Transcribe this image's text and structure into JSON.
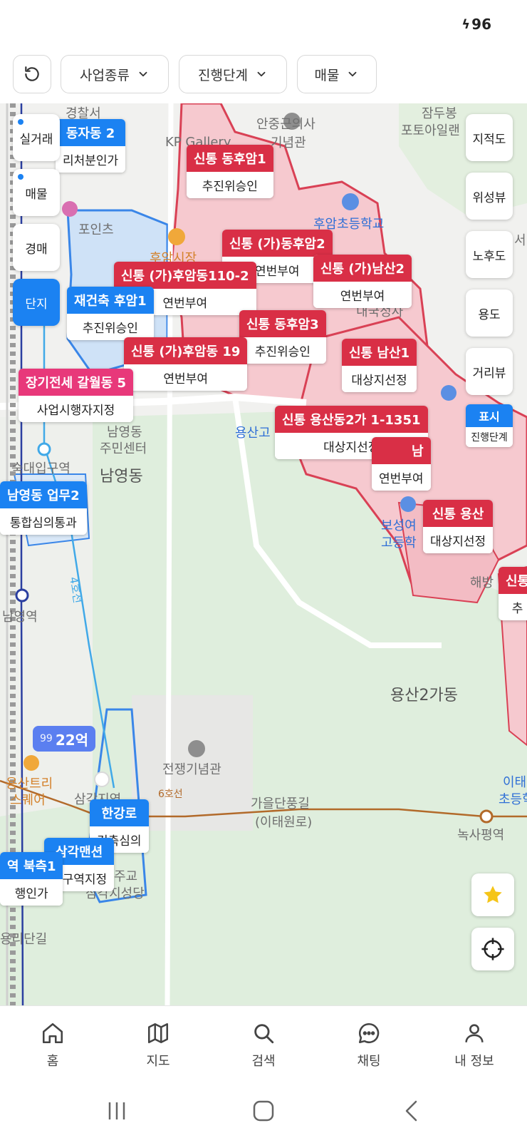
{
  "status": {
    "battery": "96"
  },
  "filters": {
    "refresh_label": "",
    "business_type": "사업종류",
    "progress_stage": "진행단계",
    "listing": "매물"
  },
  "side_left": {
    "real_trade": "실거래",
    "listing": "매물",
    "auction": "경매",
    "complex": "단지"
  },
  "side_right": {
    "cadastral": "지적도",
    "satellite": "위성뷰",
    "aging": "노후도",
    "zoning": "용도",
    "street_view": "거리뷰",
    "display_title": "표시",
    "display_sub": "진행단계"
  },
  "markers": [
    {
      "title": "동자동 2",
      "sub": "리처분인가"
    },
    {
      "title": "신통 동후암1",
      "sub": "추진위승인"
    },
    {
      "title": "신통 (가)동후암2",
      "sub": "연번부여"
    },
    {
      "title": "신통 (가)남산2",
      "sub": "연번부여"
    },
    {
      "title": "신통 (가)후암동110-2",
      "sub": "연번부여"
    },
    {
      "title": "재건축 후암1",
      "sub": "추진위승인"
    },
    {
      "title": "신통 동후암3",
      "sub": "추진위승인"
    },
    {
      "title": "신통 (가)후암동 19",
      "sub": "연번부여"
    },
    {
      "title": "신통 남산1",
      "sub": "대상지선정"
    },
    {
      "title": "장기전세 갈월동 5",
      "sub": "사업시행자지정"
    },
    {
      "title": "신통 용산동2가 1-1351",
      "sub": "대상지선정"
    },
    {
      "title": "남",
      "sub": "연번부여"
    },
    {
      "title": "남영동 업무2",
      "sub": "통합심의통과"
    },
    {
      "title": "신통 용산",
      "sub": "대상지선정"
    },
    {
      "title": "신통",
      "sub": "추"
    },
    {
      "title": "한강로",
      "sub": "건축심의"
    },
    {
      "title": "삼각맨션",
      "sub": "비구역지정"
    },
    {
      "title": "역 북측1",
      "sub": "행인가"
    }
  ],
  "places": {
    "police": "경찰서",
    "kp_gallery": "KP Gallery",
    "memorial": "안중근의사",
    "memorial2": "기념관",
    "jamdubong": "잠두봉",
    "photo": "포토아일랜",
    "huam_school": "후암초등학교",
    "huam_market": "후암시장",
    "pointes": "포인츠",
    "seo": "서",
    "namyeong_center": "남영동",
    "namyeong_center2": "주민센터",
    "sookdae": "숙대입구역",
    "namyeongdong": "남영동",
    "yongsan_high": "용산고",
    "boseong": "보성여",
    "boseong2": "고등학",
    "haebang": "해방",
    "namyeong_station": "남영역",
    "line4": "4호선",
    "yongsan2": "용산2가동",
    "war_memorial": "전쟁기념관",
    "yongsan_tree": "용산트리",
    "yongsan_tree2": "스퀘어",
    "samgakji": "삼각지역",
    "autumn_road": "가을단풍길",
    "autumn_road2": "(이태원로)",
    "noksapyeong": "녹사평역",
    "itae": "이태",
    "itae2": "초등학",
    "cathedral": "삼각지성당",
    "cathedral_pre": "주교",
    "yongri": "용리단길",
    "line6": "6호선",
    "gate": "내국정사"
  },
  "price_tag": {
    "count": "99",
    "value": "22억"
  },
  "bottom_nav": {
    "home": "홈",
    "map": "지도",
    "search": "검색",
    "chat": "채팅",
    "my": "내 정보"
  },
  "colors": {
    "accent_blue": "#1b82f2",
    "marker_red": "#d92f46",
    "marker_pink": "#e8387a",
    "zone_red_fill": "#f6c9cf",
    "zone_blue_fill": "#cfe2f7",
    "park_green": "#dfeedd"
  }
}
